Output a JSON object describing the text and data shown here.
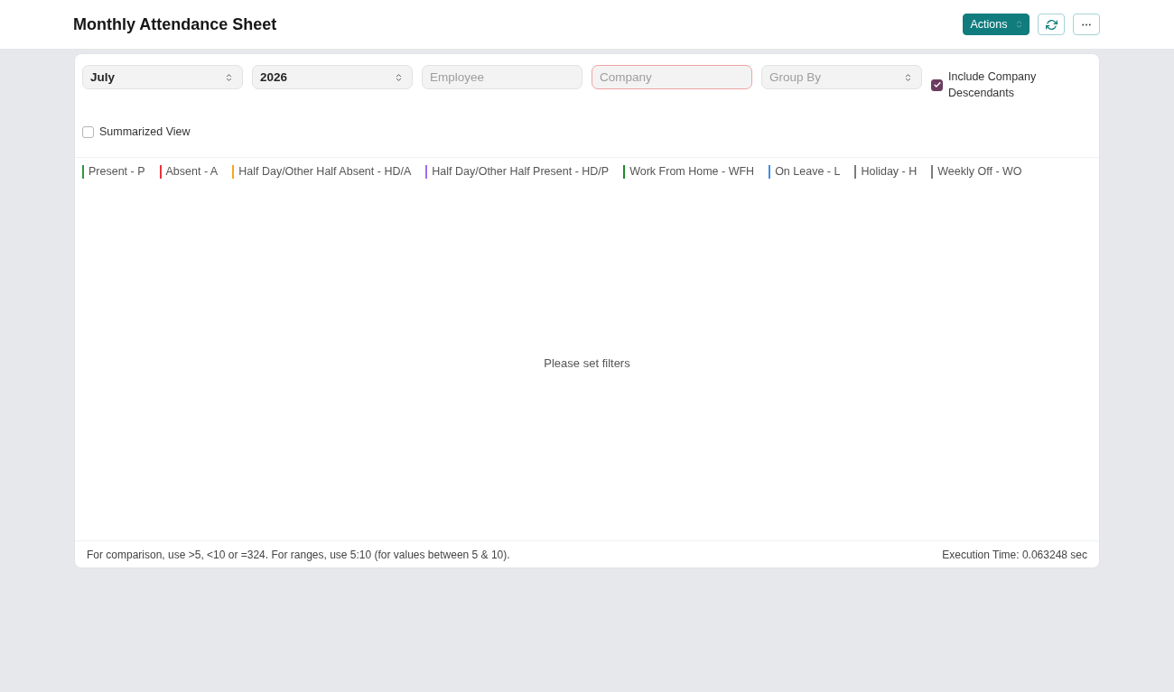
{
  "page": {
    "title": "Monthly Attendance Sheet"
  },
  "toolbar": {
    "buttons": [
      {
        "kind": "menu",
        "label": "Actions"
      },
      {
        "kind": "refresh"
      },
      {
        "kind": "more"
      }
    ]
  },
  "filters": [
    {
      "kind": "select",
      "value": "July",
      "invalid": false
    },
    {
      "kind": "select",
      "value": "2026",
      "invalid": false
    },
    {
      "kind": "link",
      "placeholder": "Employee",
      "invalid": false
    },
    {
      "kind": "link",
      "placeholder": "Company",
      "invalid": true
    },
    {
      "kind": "select",
      "placeholder": "Group By",
      "invalid": false
    },
    {
      "kind": "check",
      "label": "Include Company Descendants",
      "checked": true
    },
    {
      "kind": "check",
      "label": "Summarized View",
      "checked": false
    }
  ],
  "legend": [
    {
      "label": "Present - P",
      "color": "#2b9a3e"
    },
    {
      "label": "Absent - A",
      "color": "#e8313c"
    },
    {
      "label": "Half Day/Other Half Absent - HD/A",
      "color": "#f5a524"
    },
    {
      "label": "Half Day/Other Half Present - HD/P",
      "color": "#9c6cf0"
    },
    {
      "label": "Work From Home - WFH",
      "color": "#1f8a2e"
    },
    {
      "label": "On Leave - L",
      "color": "#3a8ee6"
    },
    {
      "label": "Holiday - H",
      "color": "#7c7c7c"
    },
    {
      "label": "Weekly Off - WO",
      "color": "#7c7c7c"
    }
  ],
  "report": {
    "message": "Please set filters"
  },
  "footer": {
    "hint": "For comparison, use >5, <10 or =324. For ranges, use 5:10 (for values between 5 & 10).",
    "execution_time": "Execution Time: 0.063248 sec"
  }
}
